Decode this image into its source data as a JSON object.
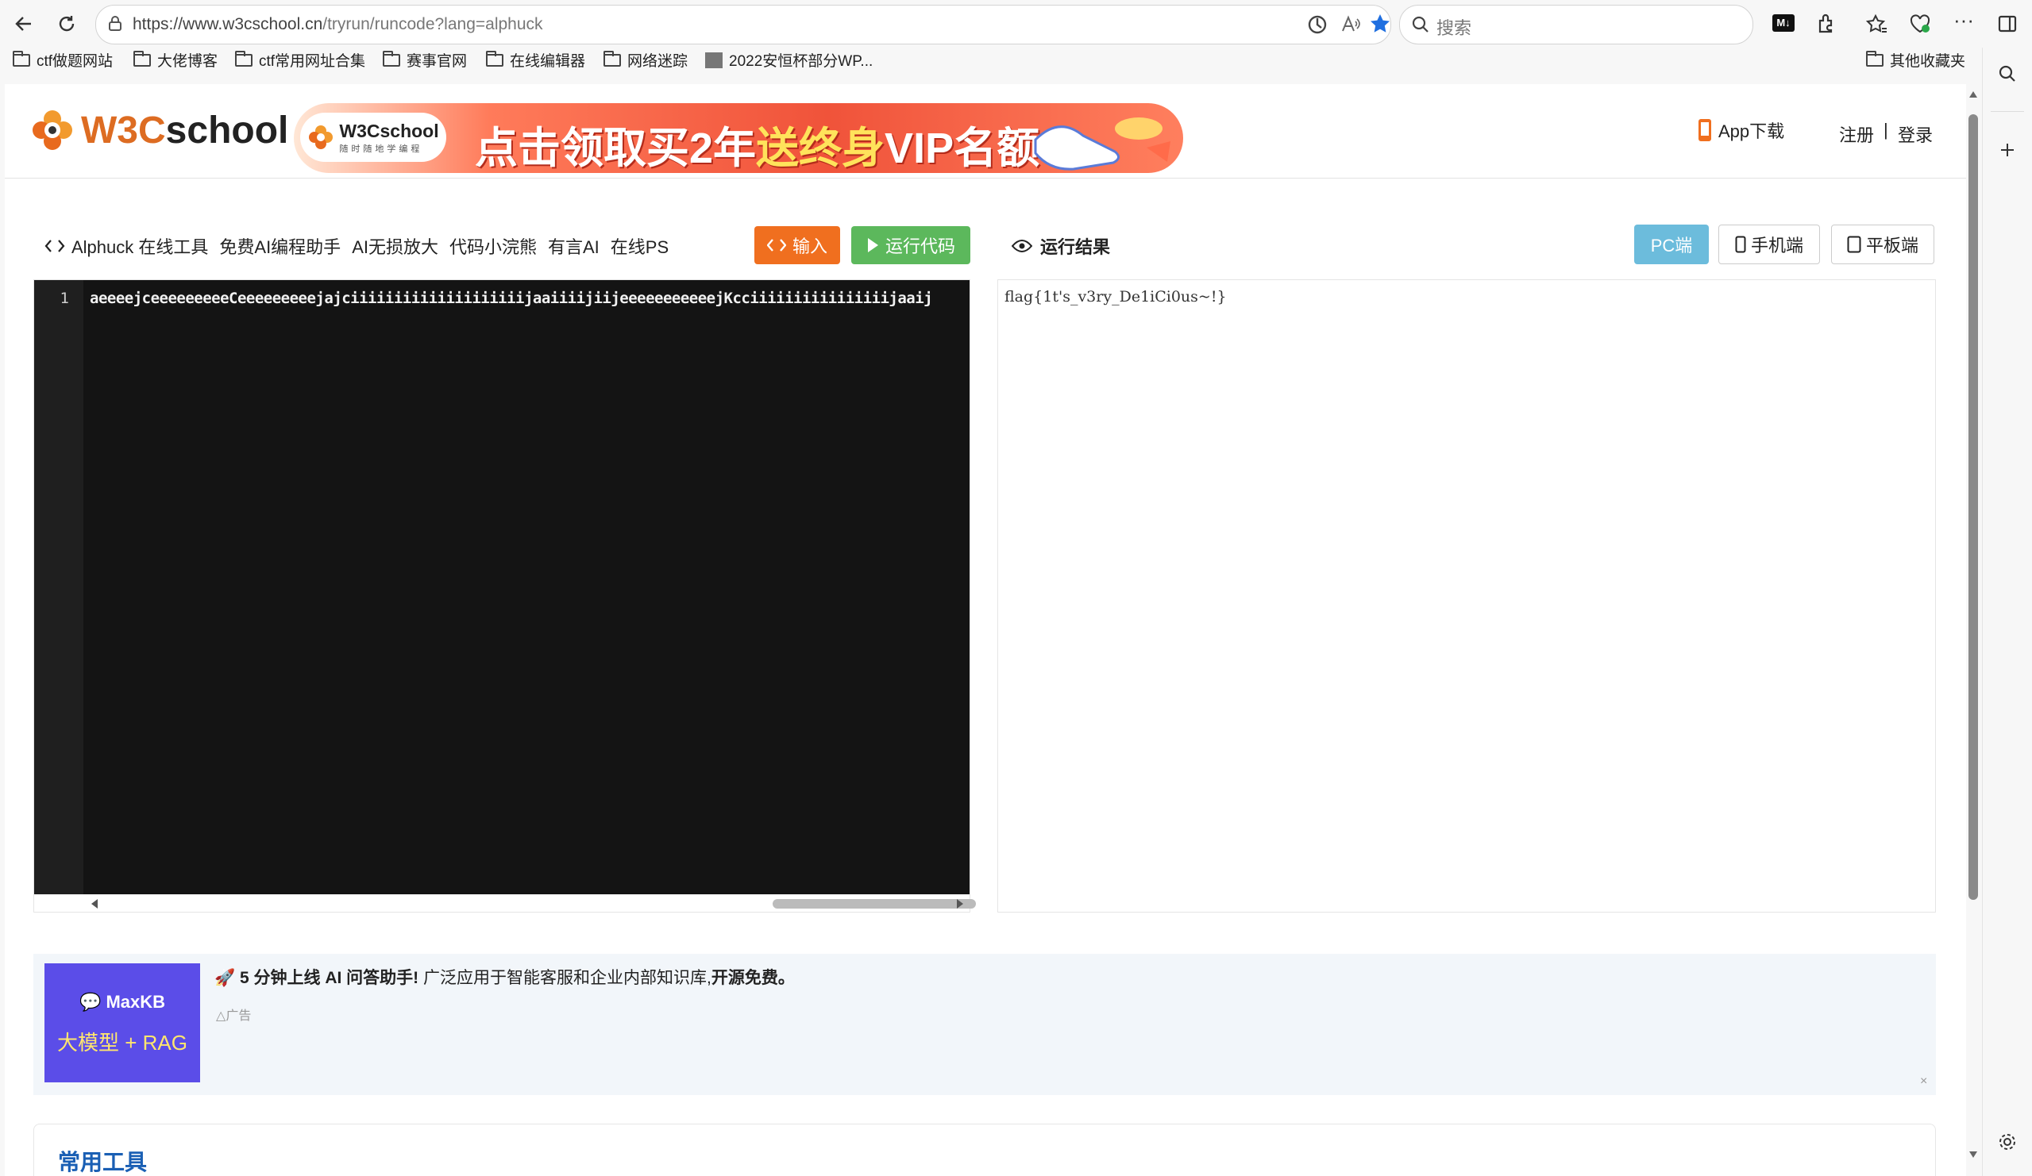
{
  "browser": {
    "url_host": "https://www.w3cschool.cn",
    "url_path": "/tryrun/runcode?lang=alphuck",
    "search_placeholder": "搜索",
    "bookmarks": [
      "ctf做题网站",
      "大佬博客",
      "ctf常用网址合集",
      "赛事官网",
      "在线编辑器",
      "网络迷踪",
      "2022安恒杯部分WP...",
      "其他收藏夹"
    ]
  },
  "site": {
    "logo_text_a": "W3C",
    "logo_text_b": "school",
    "banner_pill_title": "W3Cschool",
    "banner_pill_sub": "随时随地学编程",
    "banner_text_a": "点击领取买2年",
    "banner_text_b": "送终身",
    "banner_text_c": "VIP名额",
    "app_download": "App下载",
    "register": "注册",
    "separator": "|",
    "login": "登录"
  },
  "toolbar": {
    "tool_title": "Alphuck 在线工具",
    "links": [
      "免费AI编程助手",
      "AI无损放大",
      "代码小浣熊",
      "有言AI",
      "在线PS"
    ],
    "input_label": "输入",
    "run_label": "运行代码"
  },
  "result_panel": {
    "title": "运行结果",
    "pc_label": "PC端",
    "phone_label": "手机端",
    "tablet_label": "平板端",
    "output": "flag{1t's_v3ry_De1iCi0us~!}"
  },
  "editor": {
    "line_number": "1",
    "code": "aeeeejceeeeeeeeeCeeeeeeeeejajciiiiiiiiiiiiiiiiiiiijaaiiiijiijeeeeeeeeeeejKcciiiiiiiiiiiiiiiijaaij"
  },
  "ad": {
    "image_line1": "MaxKB",
    "image_line2": "大模型 + RAG",
    "headline_bold": "5 分钟上线 AI 问答助手!",
    "headline_rest": "广泛应用于智能客服和企业内部知识库,",
    "headline_tail": "开源免费。",
    "label": "广告",
    "close": "×"
  },
  "tools_card": {
    "title": "常用工具"
  },
  "colors": {
    "accent_orange": "#f06f1f",
    "run_green": "#5cb85c",
    "pc_blue": "#6cbcdc",
    "editor_bg": "#141414"
  }
}
